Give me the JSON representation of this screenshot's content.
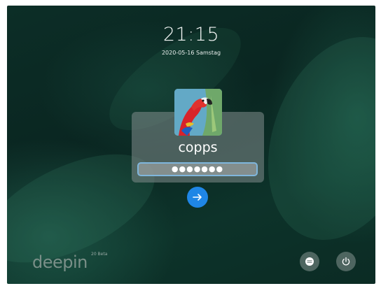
{
  "lock_screen": {
    "time": "21:15",
    "date": "2020-05-16 Samstag",
    "user": {
      "name": "copps",
      "avatar_icon": "parrot-avatar"
    },
    "password": {
      "value": "●●●●●●●"
    },
    "login_button": {
      "icon": "arrow-right-icon",
      "color": "#1f86e6"
    },
    "brand": {
      "name": "deepin",
      "version": "20 Beta"
    },
    "system_buttons": [
      {
        "name": "switch-user",
        "icon": "switch-user-icon"
      },
      {
        "name": "power",
        "icon": "power-icon"
      }
    ]
  }
}
